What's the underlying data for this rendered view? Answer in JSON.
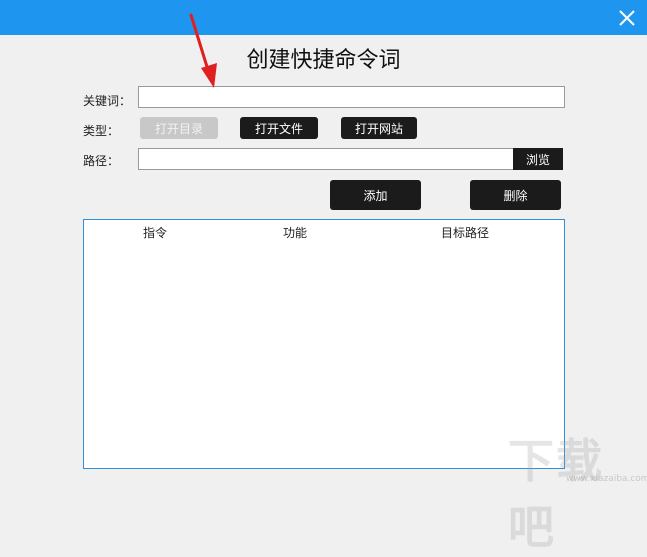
{
  "window": {
    "title": "创建快捷命令词"
  },
  "form": {
    "keyword_label": "关键词：",
    "keyword_value": "",
    "type_label": "类型：",
    "type_options": [
      "打开目录",
      "打开文件",
      "打开网站"
    ],
    "path_label": "路径：",
    "path_value": "",
    "browse_label": "浏览"
  },
  "actions": {
    "add_label": "添加",
    "delete_label": "删除"
  },
  "table": {
    "columns": [
      "指令",
      "功能",
      "目标路径"
    ],
    "rows": []
  },
  "watermark": {
    "logo_text": "下载吧",
    "url": "www.xiazaiba.com"
  },
  "colors": {
    "titlebar": "#1e96f0",
    "button_dark": "#1b1b1b",
    "button_disabled": "#c8c8c8",
    "list_border": "#2f8fd8",
    "annotation_arrow": "#e02020"
  }
}
